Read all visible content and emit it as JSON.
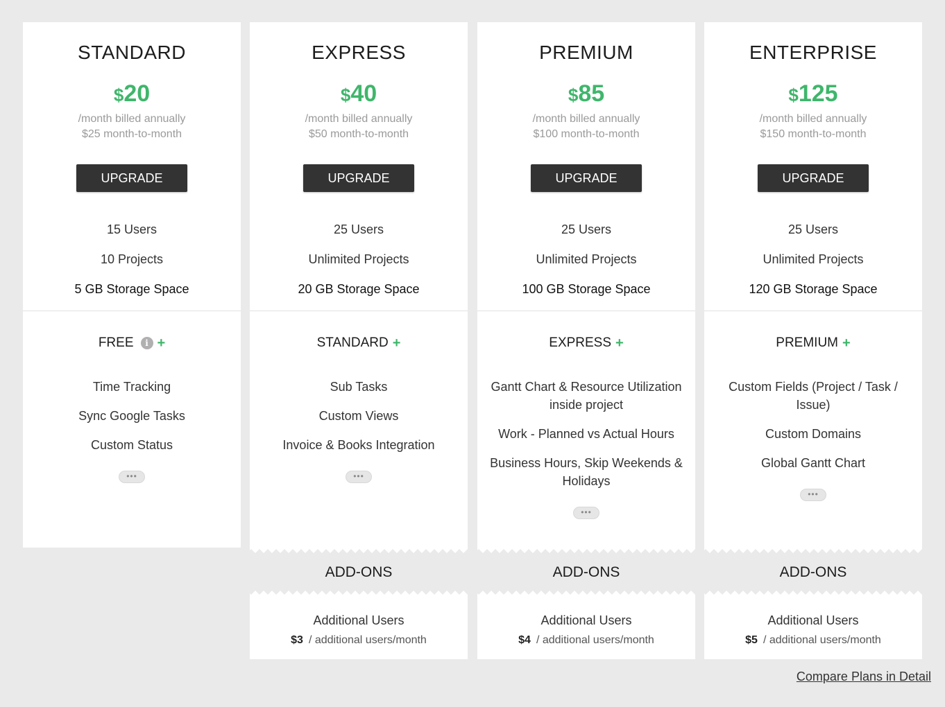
{
  "plans": [
    {
      "name": "STANDARD",
      "currency": "$",
      "price": "20",
      "billed": "/month billed annually",
      "monthly": "$25 month-to-month",
      "button": "UPGRADE",
      "specs": [
        "15 Users",
        "10 Projects",
        "5 GB Storage Space"
      ],
      "tier": "FREE",
      "features": [
        "Time Tracking",
        "Sync Google Tasks",
        "Custom Status"
      ]
    },
    {
      "name": "EXPRESS",
      "currency": "$",
      "price": "40",
      "billed": "/month billed annually",
      "monthly": "$50 month-to-month",
      "button": "UPGRADE",
      "specs": [
        "25 Users",
        "Unlimited Projects",
        "20 GB Storage Space"
      ],
      "tier": "STANDARD",
      "features": [
        "Sub Tasks",
        "Custom Views",
        "Invoice & Books Integration"
      ],
      "addon": {
        "title": "ADD-ONS",
        "label": "Additional Users",
        "price": "$3",
        "unit": "/ additional users/month"
      }
    },
    {
      "name": "PREMIUM",
      "currency": "$",
      "price": "85",
      "billed": "/month billed annually",
      "monthly": "$100 month-to-month",
      "button": "UPGRADE",
      "specs": [
        "25 Users",
        "Unlimited Projects",
        "100 GB Storage Space"
      ],
      "tier": "EXPRESS",
      "features": [
        "Gantt Chart & Resource Utilization inside project",
        "Work - Planned vs Actual Hours",
        "Business Hours, Skip Weekends & Holidays"
      ],
      "addon": {
        "title": "ADD-ONS",
        "label": "Additional Users",
        "price": "$4",
        "unit": "/ additional users/month"
      }
    },
    {
      "name": "ENTERPRISE",
      "currency": "$",
      "price": "125",
      "billed": "/month billed annually",
      "monthly": "$150 month-to-month",
      "button": "UPGRADE",
      "specs": [
        "25 Users",
        "Unlimited Projects",
        "120 GB Storage Space"
      ],
      "tier": "PREMIUM",
      "features": [
        "Custom Fields (Project / Task / Issue)",
        "Custom Domains",
        "Global Gantt Chart"
      ],
      "addon": {
        "title": "ADD-ONS",
        "label": "Additional Users",
        "price": "$5",
        "unit": "/ additional users/month"
      }
    }
  ],
  "icons": {
    "plus": "+",
    "info": "i",
    "more": "•••"
  },
  "colors": {
    "accent": "#3fb66b",
    "button": "#333333",
    "background": "#eaeaea"
  },
  "compare_link": "Compare Plans in Detail"
}
